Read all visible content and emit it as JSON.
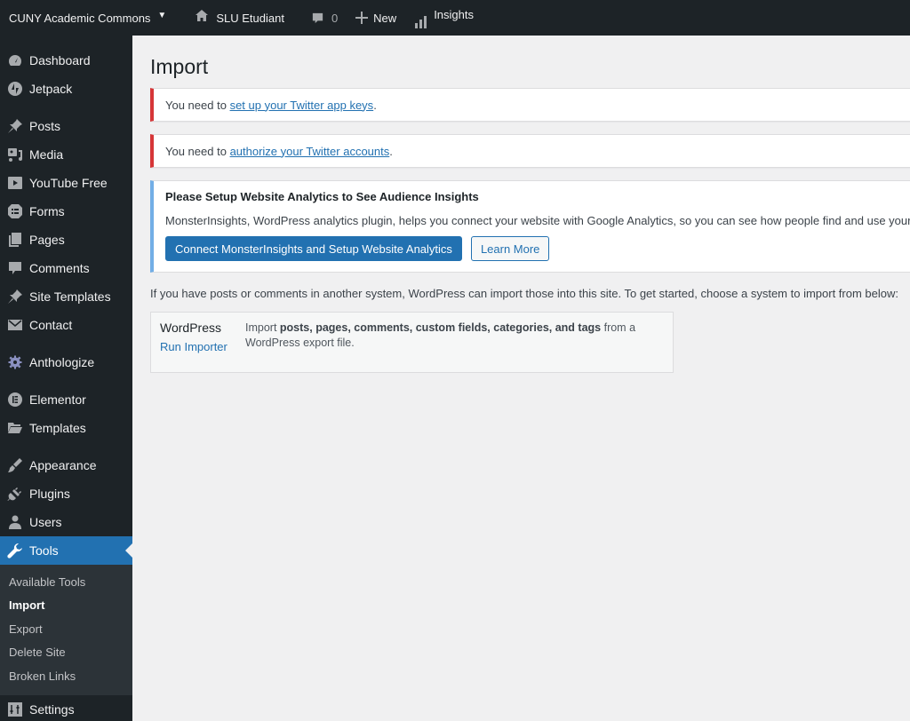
{
  "adminbar": {
    "site_name": "CUNY Academic Commons",
    "site_caret": "▼",
    "home_label": "SLU Etudiant",
    "comments_count": "0",
    "new_label": "New",
    "insights_label": "Insights"
  },
  "sidebar": {
    "items": [
      {
        "label": "Dashboard",
        "icon": "dashboard-icon"
      },
      {
        "label": "Jetpack",
        "icon": "jetpack-icon"
      },
      {
        "label": "Posts",
        "icon": "pin-icon"
      },
      {
        "label": "Media",
        "icon": "media-icon"
      },
      {
        "label": "YouTube Free",
        "icon": "youtube-icon"
      },
      {
        "label": "Forms",
        "icon": "forms-icon"
      },
      {
        "label": "Pages",
        "icon": "pages-icon"
      },
      {
        "label": "Comments",
        "icon": "comment-icon"
      },
      {
        "label": "Site Templates",
        "icon": "pin-icon"
      },
      {
        "label": "Contact",
        "icon": "envelope-icon"
      },
      {
        "label": "Anthologize",
        "icon": "gear-icon"
      },
      {
        "label": "Elementor",
        "icon": "elementor-icon"
      },
      {
        "label": "Templates",
        "icon": "folder-icon"
      },
      {
        "label": "Appearance",
        "icon": "paintbrush-icon"
      },
      {
        "label": "Plugins",
        "icon": "plug-icon"
      },
      {
        "label": "Users",
        "icon": "user-icon"
      },
      {
        "label": "Tools",
        "icon": "wrench-icon"
      },
      {
        "label": "Settings",
        "icon": "settings-icon"
      }
    ],
    "tools_submenu": [
      "Available Tools",
      "Import",
      "Export",
      "Delete Site",
      "Broken Links"
    ],
    "current_item": "Tools",
    "current_subitem": "Import"
  },
  "page": {
    "title": "Import",
    "notices": [
      {
        "prefix": "You need to ",
        "link": "set up your Twitter app keys",
        "suffix": "."
      },
      {
        "prefix": "You need to ",
        "link": "authorize your Twitter accounts",
        "suffix": "."
      }
    ],
    "monsterinsights": {
      "title": "Please Setup Website Analytics to See Audience Insights",
      "description": "MonsterInsights, WordPress analytics plugin, helps you connect your website with Google Analytics, so you can see how people find and use your website.",
      "primary_button": "Connect MonsterInsights and Setup Website Analytics",
      "secondary_button": "Learn More"
    },
    "intro": "If you have posts or comments in another system, WordPress can import those into this site. To get started, choose a system to import from below:",
    "importers": [
      {
        "name": "WordPress",
        "action": "Run Importer",
        "desc_prefix": "Import ",
        "desc_bold": "posts, pages, comments, custom fields, categories, and tags",
        "desc_suffix": " from a WordPress export file."
      }
    ]
  },
  "colors": {
    "accent": "#2271b1",
    "error": "#d63638",
    "info": "#72aee6",
    "sidebar_bg": "#1d2327"
  }
}
